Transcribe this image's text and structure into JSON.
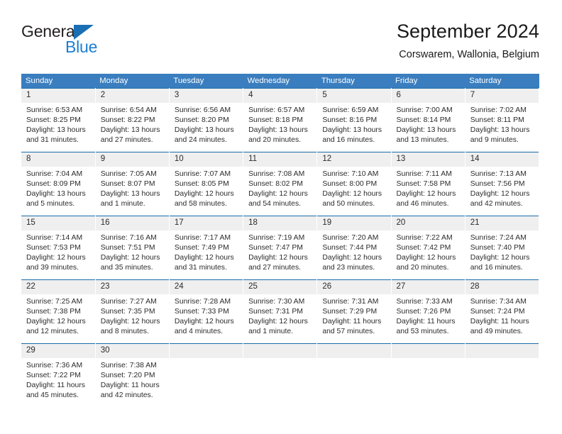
{
  "brand": {
    "name_part1": "General",
    "name_part2": "Blue",
    "accent_color": "#1a7fd4",
    "triangle_color": "#1a6fb4"
  },
  "header": {
    "title": "September 2024",
    "subtitle": "Corswarem, Wallonia, Belgium"
  },
  "calendar": {
    "header_bg": "#3a7ebf",
    "header_text_color": "#ffffff",
    "cell_border_color": "#1b6ba8",
    "daynum_bg": "#efefef",
    "weekdays": [
      "Sunday",
      "Monday",
      "Tuesday",
      "Wednesday",
      "Thursday",
      "Friday",
      "Saturday"
    ],
    "labels": {
      "sunrise": "Sunrise:",
      "sunset": "Sunset:",
      "daylight": "Daylight:"
    },
    "weeks": [
      [
        {
          "day": "1",
          "sunrise": "Sunrise: 6:53 AM",
          "sunset": "Sunset: 8:25 PM",
          "daylight": "Daylight: 13 hours and 31 minutes."
        },
        {
          "day": "2",
          "sunrise": "Sunrise: 6:54 AM",
          "sunset": "Sunset: 8:22 PM",
          "daylight": "Daylight: 13 hours and 27 minutes."
        },
        {
          "day": "3",
          "sunrise": "Sunrise: 6:56 AM",
          "sunset": "Sunset: 8:20 PM",
          "daylight": "Daylight: 13 hours and 24 minutes."
        },
        {
          "day": "4",
          "sunrise": "Sunrise: 6:57 AM",
          "sunset": "Sunset: 8:18 PM",
          "daylight": "Daylight: 13 hours and 20 minutes."
        },
        {
          "day": "5",
          "sunrise": "Sunrise: 6:59 AM",
          "sunset": "Sunset: 8:16 PM",
          "daylight": "Daylight: 13 hours and 16 minutes."
        },
        {
          "day": "6",
          "sunrise": "Sunrise: 7:00 AM",
          "sunset": "Sunset: 8:14 PM",
          "daylight": "Daylight: 13 hours and 13 minutes."
        },
        {
          "day": "7",
          "sunrise": "Sunrise: 7:02 AM",
          "sunset": "Sunset: 8:11 PM",
          "daylight": "Daylight: 13 hours and 9 minutes."
        }
      ],
      [
        {
          "day": "8",
          "sunrise": "Sunrise: 7:04 AM",
          "sunset": "Sunset: 8:09 PM",
          "daylight": "Daylight: 13 hours and 5 minutes."
        },
        {
          "day": "9",
          "sunrise": "Sunrise: 7:05 AM",
          "sunset": "Sunset: 8:07 PM",
          "daylight": "Daylight: 13 hours and 1 minute."
        },
        {
          "day": "10",
          "sunrise": "Sunrise: 7:07 AM",
          "sunset": "Sunset: 8:05 PM",
          "daylight": "Daylight: 12 hours and 58 minutes."
        },
        {
          "day": "11",
          "sunrise": "Sunrise: 7:08 AM",
          "sunset": "Sunset: 8:02 PM",
          "daylight": "Daylight: 12 hours and 54 minutes."
        },
        {
          "day": "12",
          "sunrise": "Sunrise: 7:10 AM",
          "sunset": "Sunset: 8:00 PM",
          "daylight": "Daylight: 12 hours and 50 minutes."
        },
        {
          "day": "13",
          "sunrise": "Sunrise: 7:11 AM",
          "sunset": "Sunset: 7:58 PM",
          "daylight": "Daylight: 12 hours and 46 minutes."
        },
        {
          "day": "14",
          "sunrise": "Sunrise: 7:13 AM",
          "sunset": "Sunset: 7:56 PM",
          "daylight": "Daylight: 12 hours and 42 minutes."
        }
      ],
      [
        {
          "day": "15",
          "sunrise": "Sunrise: 7:14 AM",
          "sunset": "Sunset: 7:53 PM",
          "daylight": "Daylight: 12 hours and 39 minutes."
        },
        {
          "day": "16",
          "sunrise": "Sunrise: 7:16 AM",
          "sunset": "Sunset: 7:51 PM",
          "daylight": "Daylight: 12 hours and 35 minutes."
        },
        {
          "day": "17",
          "sunrise": "Sunrise: 7:17 AM",
          "sunset": "Sunset: 7:49 PM",
          "daylight": "Daylight: 12 hours and 31 minutes."
        },
        {
          "day": "18",
          "sunrise": "Sunrise: 7:19 AM",
          "sunset": "Sunset: 7:47 PM",
          "daylight": "Daylight: 12 hours and 27 minutes."
        },
        {
          "day": "19",
          "sunrise": "Sunrise: 7:20 AM",
          "sunset": "Sunset: 7:44 PM",
          "daylight": "Daylight: 12 hours and 23 minutes."
        },
        {
          "day": "20",
          "sunrise": "Sunrise: 7:22 AM",
          "sunset": "Sunset: 7:42 PM",
          "daylight": "Daylight: 12 hours and 20 minutes."
        },
        {
          "day": "21",
          "sunrise": "Sunrise: 7:24 AM",
          "sunset": "Sunset: 7:40 PM",
          "daylight": "Daylight: 12 hours and 16 minutes."
        }
      ],
      [
        {
          "day": "22",
          "sunrise": "Sunrise: 7:25 AM",
          "sunset": "Sunset: 7:38 PM",
          "daylight": "Daylight: 12 hours and 12 minutes."
        },
        {
          "day": "23",
          "sunrise": "Sunrise: 7:27 AM",
          "sunset": "Sunset: 7:35 PM",
          "daylight": "Daylight: 12 hours and 8 minutes."
        },
        {
          "day": "24",
          "sunrise": "Sunrise: 7:28 AM",
          "sunset": "Sunset: 7:33 PM",
          "daylight": "Daylight: 12 hours and 4 minutes."
        },
        {
          "day": "25",
          "sunrise": "Sunrise: 7:30 AM",
          "sunset": "Sunset: 7:31 PM",
          "daylight": "Daylight: 12 hours and 1 minute."
        },
        {
          "day": "26",
          "sunrise": "Sunrise: 7:31 AM",
          "sunset": "Sunset: 7:29 PM",
          "daylight": "Daylight: 11 hours and 57 minutes."
        },
        {
          "day": "27",
          "sunrise": "Sunrise: 7:33 AM",
          "sunset": "Sunset: 7:26 PM",
          "daylight": "Daylight: 11 hours and 53 minutes."
        },
        {
          "day": "28",
          "sunrise": "Sunrise: 7:34 AM",
          "sunset": "Sunset: 7:24 PM",
          "daylight": "Daylight: 11 hours and 49 minutes."
        }
      ],
      [
        {
          "day": "29",
          "sunrise": "Sunrise: 7:36 AM",
          "sunset": "Sunset: 7:22 PM",
          "daylight": "Daylight: 11 hours and 45 minutes."
        },
        {
          "day": "30",
          "sunrise": "Sunrise: 7:38 AM",
          "sunset": "Sunset: 7:20 PM",
          "daylight": "Daylight: 11 hours and 42 minutes."
        },
        {
          "day": "",
          "sunrise": "",
          "sunset": "",
          "daylight": ""
        },
        {
          "day": "",
          "sunrise": "",
          "sunset": "",
          "daylight": ""
        },
        {
          "day": "",
          "sunrise": "",
          "sunset": "",
          "daylight": ""
        },
        {
          "day": "",
          "sunrise": "",
          "sunset": "",
          "daylight": ""
        },
        {
          "day": "",
          "sunrise": "",
          "sunset": "",
          "daylight": ""
        }
      ]
    ]
  }
}
